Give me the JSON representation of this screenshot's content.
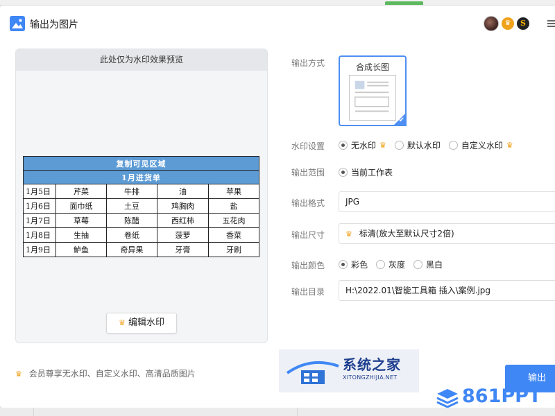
{
  "header": {
    "title": "输出为图片"
  },
  "preview": {
    "heading": "此处仅为水印效果预览",
    "sheet": {
      "region_label": "复制可见区域",
      "title": "1月进货单",
      "rows": [
        [
          "1月5日",
          "芹菜",
          "牛排",
          "油",
          "苹果"
        ],
        [
          "1月6日",
          "面巾纸",
          "土豆",
          "鸡胸肉",
          "盐"
        ],
        [
          "1月7日",
          "草莓",
          "陈醋",
          "西红柿",
          "五花肉"
        ],
        [
          "1月8日",
          "生抽",
          "卷纸",
          "菠萝",
          "香菜"
        ],
        [
          "1月9日",
          "鲈鱼",
          "奇异果",
          "牙膏",
          "牙刷"
        ]
      ]
    },
    "edit_button": "编辑水印"
  },
  "settings": {
    "output_mode_label": "输出方式",
    "output_mode_option": "合成长图",
    "watermark_label": "水印设置",
    "watermark_options": [
      "无水印",
      "默认水印",
      "自定义水印"
    ],
    "watermark_selected": "无水印",
    "range_label": "输出范围",
    "range_option": "当前工作表",
    "format_label": "输出格式",
    "format_value": "JPG",
    "size_label": "输出尺寸",
    "size_value": "标清(放大至默认尺寸2倍)",
    "color_label": "输出颜色",
    "color_options": [
      "彩色",
      "灰度",
      "黑白"
    ],
    "color_selected": "彩色",
    "dir_label": "输出目录",
    "dir_value": "H:\\2022.01\\智能工具箱 插入\\案例.jpg"
  },
  "footer": {
    "vip_note": "会员尊享无水印、自定义水印、高清品质图片",
    "export_button": "输出"
  },
  "watermarks": {
    "site1_name": "系统之家",
    "site1_url": "XITONGZHIJIA.NET",
    "site2_name": "861PPT"
  },
  "colors": {
    "accent": "#3f87f5",
    "crown": "#f0a21c",
    "sheet_header": "#5d9bd5"
  }
}
